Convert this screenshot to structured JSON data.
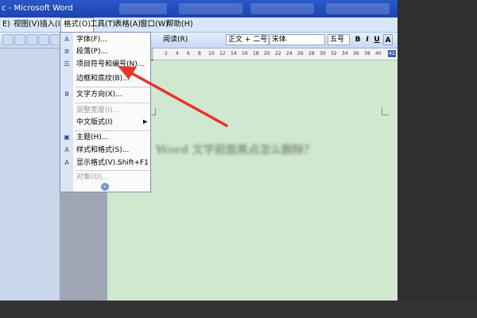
{
  "window": {
    "title": "c - Microsoft Word"
  },
  "menubar": {
    "items": [
      {
        "label": "E)"
      },
      {
        "label": "视图(V)"
      },
      {
        "label": "插入(I)"
      },
      {
        "label": "格式(O)"
      },
      {
        "label": "工具(T)"
      },
      {
        "label": "表格(A)"
      },
      {
        "label": "窗口(W)"
      },
      {
        "label": "帮助(H)"
      }
    ]
  },
  "toolbar": {
    "read_label": "阅读(R)",
    "style_value": "正文 + 二号",
    "font_value": "宋体",
    "size_value": "五号",
    "bold": "B",
    "italic": "I",
    "underline": "U",
    "font_color": "A"
  },
  "ruler": {
    "numbers": [
      "2",
      "4",
      "6",
      "8",
      "10",
      "12",
      "14",
      "16",
      "18",
      "20",
      "22",
      "24",
      "26",
      "28",
      "30",
      "32",
      "34",
      "36",
      "38",
      "40"
    ],
    "corner": "42"
  },
  "format_menu": {
    "items": {
      "font": "字体(F)...",
      "paragraph": "段落(P)...",
      "bullets": "项目符号和编号(N)...",
      "borders": "边框和底纹(B)...",
      "text_direction": "文字方向(X)...",
      "adjust_width": "调整宽度(I)...",
      "asian_layout": "中文版式(I)",
      "theme": "主题(H)...",
      "styles": "样式和格式(S)...",
      "reveal": "显示格式(V)...",
      "reveal_shortcut": "Shift+F1",
      "object": "对象(O)..."
    },
    "expand": "»"
  },
  "document": {
    "blurred_text": "Word 文字前面黑点怎么删除？"
  },
  "colors": {
    "title_bar": "#2a58c8",
    "menu_bar": "#d9e6f8",
    "doc_background": "#cfe8cf",
    "arrow": "#e8322a"
  }
}
